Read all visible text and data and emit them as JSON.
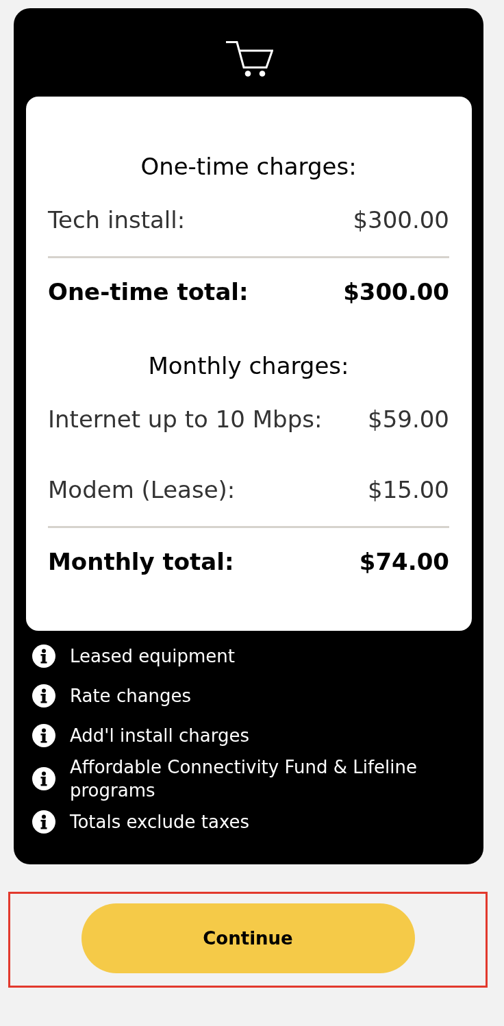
{
  "summary": {
    "sections": [
      {
        "heading": "One-time charges:",
        "items": [
          {
            "label": "Tech install:",
            "amount": "$300.00"
          }
        ],
        "total": {
          "label": "One-time total:",
          "amount": "$300.00"
        }
      },
      {
        "heading": "Monthly charges:",
        "items": [
          {
            "label": "Internet up to 10 Mbps:",
            "amount": "$59.00"
          },
          {
            "label": "Modem (Lease):",
            "amount": "$15.00"
          }
        ],
        "total": {
          "label": "Monthly total:",
          "amount": "$74.00"
        }
      }
    ]
  },
  "notes": [
    {
      "text": "Leased equipment"
    },
    {
      "text": "Rate changes"
    },
    {
      "text": "Add'l install charges"
    },
    {
      "text": "Affordable Connectivity Fund & Lifeline programs"
    },
    {
      "text": "Totals exclude taxes"
    }
  ],
  "continue_button": {
    "label": "Continue",
    "highlighted": true
  }
}
